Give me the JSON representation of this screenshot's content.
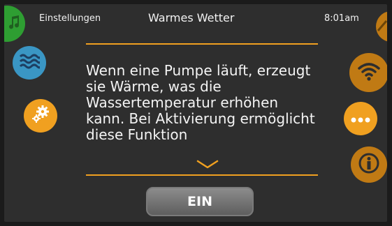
{
  "header": {
    "settings_label": "Einstellungen",
    "title": "Warmes Wetter",
    "time": "8:01am"
  },
  "content": {
    "text": "Wenn eine Pumpe läuft, erzeugt sie Wärme, was die Wassertemperatur erhöhen kann. Bei Aktivierung ermöglicht diese Funktion"
  },
  "button": {
    "label": "EIN"
  },
  "icons": {
    "left": [
      "music-icon",
      "water-waves-icon",
      "gears-icon"
    ],
    "right": [
      "brightness-icon",
      "wifi-icon",
      "more-dots-icon",
      "info-icon"
    ]
  },
  "colors": {
    "accent": "#f0a020",
    "orange_dim": "#c07a14",
    "green": "#2e9e32",
    "blue": "#3a96c4",
    "background": "#2e2e2e"
  }
}
